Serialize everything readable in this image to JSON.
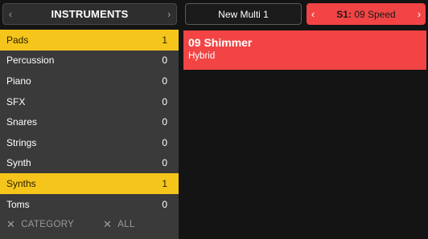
{
  "header": {
    "title": "INSTRUMENTS",
    "prev_icon": "chevron-left-icon",
    "next_icon": "chevron-right-icon",
    "multi_name": "New Multi 1",
    "slot_prefix": "S1:",
    "slot_preset": "09 Speed"
  },
  "categories": [
    {
      "label": "Pads",
      "count": "1",
      "selected": true
    },
    {
      "label": "Percussion",
      "count": "0",
      "selected": false
    },
    {
      "label": "Piano",
      "count": "0",
      "selected": false
    },
    {
      "label": "SFX",
      "count": "0",
      "selected": false
    },
    {
      "label": "Snares",
      "count": "0",
      "selected": false
    },
    {
      "label": "Strings",
      "count": "0",
      "selected": false
    },
    {
      "label": "Synth",
      "count": "0",
      "selected": false
    },
    {
      "label": "Synths",
      "count": "1",
      "selected": true
    },
    {
      "label": "Toms",
      "count": "0",
      "selected": false
    }
  ],
  "footer": {
    "clear_category": "CATEGORY",
    "clear_all": "ALL",
    "icon": "close-icon"
  },
  "preset": {
    "name": "09 Shimmer",
    "type": "Hybrid"
  },
  "colors": {
    "selection": "#f5c51b",
    "accent_red": "#f24444",
    "sidebar": "#3a3a3a",
    "background": "#141414"
  }
}
